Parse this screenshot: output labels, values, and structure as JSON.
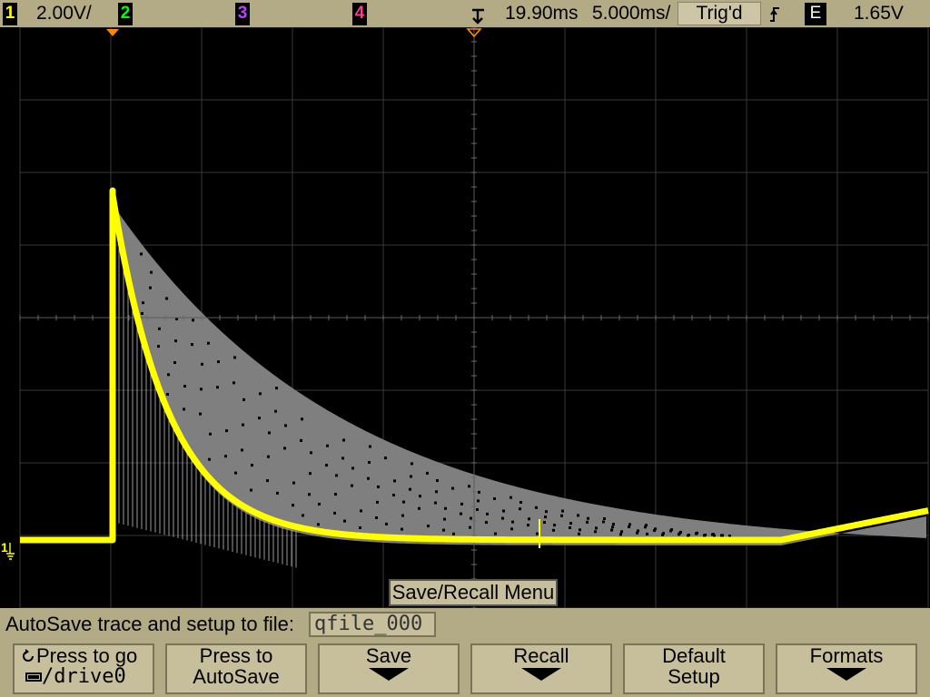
{
  "topbar": {
    "ch1": {
      "num": "1",
      "color": "#ffff00",
      "scale": "2.00V/"
    },
    "ch2": {
      "num": "2",
      "color": "#00ff00"
    },
    "ch3": {
      "num": "3",
      "color": "#c040ff"
    },
    "ch4": {
      "num": "4",
      "color": "#ff3b8b"
    },
    "trigger_icon": "trigger-position-icon",
    "delay": "19.90ms",
    "timebase": "5.000ms/",
    "trig_status": "Trig'd",
    "slope_icon": "rising-edge-icon",
    "trig_source": "E",
    "trig_level": "1.65V"
  },
  "screen": {
    "ground_marker": "1",
    "trace_color": "#ffff00",
    "persistence_color": "#7f7f7f"
  },
  "menu": {
    "title": "Save/Recall Menu",
    "autosave_label": "AutoSave trace and setup to file:",
    "filename": "qfile_000"
  },
  "softkeys": [
    {
      "l1": "Press to go",
      "l2": "/drive0"
    },
    {
      "l1": "Press to",
      "l2": "AutoSave"
    },
    {
      "l1": "Save",
      "l2": ""
    },
    {
      "l1": "Recall",
      "l2": ""
    },
    {
      "l1": "Default",
      "l2": "Setup"
    },
    {
      "l1": "Formats",
      "l2": ""
    }
  ]
}
